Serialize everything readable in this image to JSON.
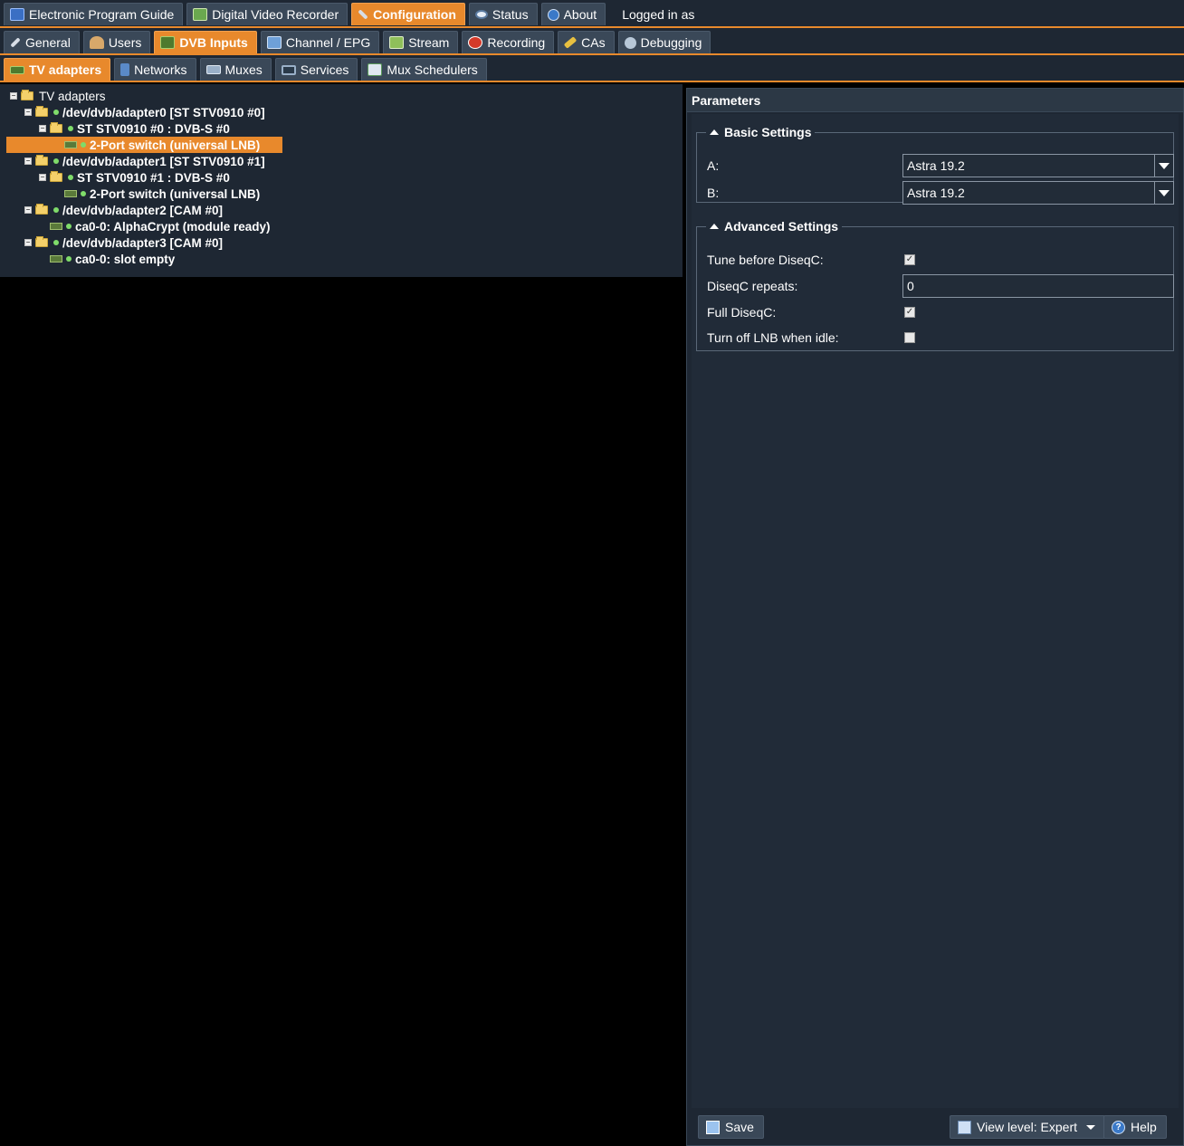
{
  "top_tabs": [
    {
      "label": "Electronic Program Guide",
      "icon": "epg-icon"
    },
    {
      "label": "Digital Video Recorder",
      "icon": "dvr-icon"
    },
    {
      "label": "Configuration",
      "icon": "wrench-icon",
      "active": true
    },
    {
      "label": "Status",
      "icon": "eye-icon"
    },
    {
      "label": "About",
      "icon": "info-icon"
    }
  ],
  "logged_in": "Logged in as",
  "config_tabs": [
    {
      "label": "General",
      "icon": "wrench-icon"
    },
    {
      "label": "Users",
      "icon": "users-icon"
    },
    {
      "label": "DVB Inputs",
      "icon": "tv-card-icon",
      "active": true
    },
    {
      "label": "Channel / EPG",
      "icon": "tv-icon"
    },
    {
      "label": "Stream",
      "icon": "stream-icon"
    },
    {
      "label": "Recording",
      "icon": "rec-icon"
    },
    {
      "label": "CAs",
      "icon": "key-icon"
    },
    {
      "label": "Debugging",
      "icon": "bug-icon"
    }
  ],
  "dvb_tabs": [
    {
      "label": "TV adapters",
      "icon": "tv-card-icon",
      "active": true
    },
    {
      "label": "Networks",
      "icon": "antenna-icon"
    },
    {
      "label": "Muxes",
      "icon": "mux-icon"
    },
    {
      "label": "Services",
      "icon": "monitor-icon"
    },
    {
      "label": "Mux Schedulers",
      "icon": "scheduler-icon"
    }
  ],
  "tree": {
    "root": "TV adapters",
    "adapter0": "/dev/dvb/adapter0 [ST STV0910 #0]",
    "frontend0": "ST STV0910 #0 : DVB-S #0",
    "lnb0": "2-Port switch (universal LNB)",
    "adapter1": "/dev/dvb/adapter1 [ST STV0910 #1]",
    "frontend1": "ST STV0910 #1 : DVB-S #0",
    "lnb1": "2-Port switch (universal LNB)",
    "adapter2": "/dev/dvb/adapter2 [CAM #0]",
    "ca2": "ca0-0: AlphaCrypt (module ready)",
    "adapter3": "/dev/dvb/adapter3 [CAM #0]",
    "ca3": "ca0-0: slot empty"
  },
  "params": {
    "title": "Parameters",
    "basic_legend": "Basic Settings",
    "a_label": "A:",
    "a_value": "Astra 19.2",
    "b_label": "B:",
    "b_value": "Astra 19.2",
    "advanced_legend": "Advanced Settings",
    "tune_label": "Tune before DiseqC:",
    "tune_checked": true,
    "repeats_label": "DiseqC repeats:",
    "repeats_value": "0",
    "full_label": "Full DiseqC:",
    "full_checked": true,
    "lnb_off_label": "Turn off LNB when idle:",
    "lnb_off_checked": false
  },
  "toolbar": {
    "save": "Save",
    "view_level": "View level: Expert",
    "help": "Help"
  },
  "colors": {
    "accent": "#e8892c",
    "panel": "#1e2733",
    "tab": "#3a4858",
    "status_ok": "#7fdc6a"
  }
}
